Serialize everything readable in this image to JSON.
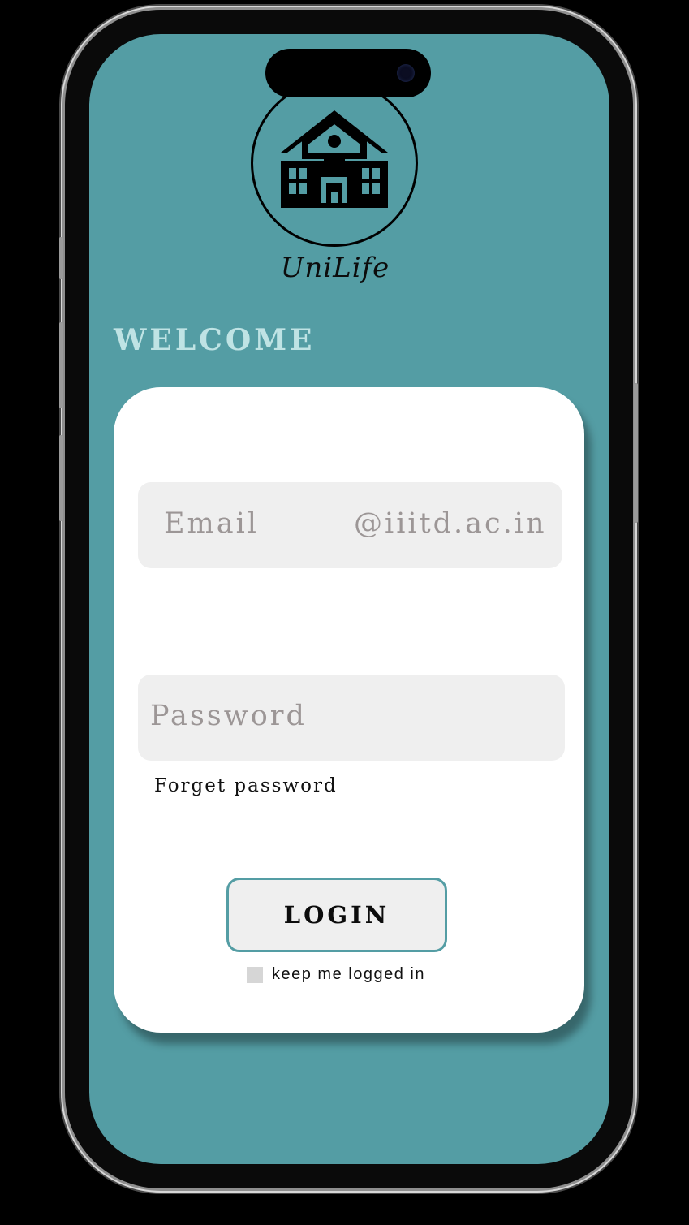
{
  "colors": {
    "screen_bg": "#549da4",
    "welcome_text": "#bfe3e4",
    "card_bg": "#ffffff",
    "field_bg": "#efefef"
  },
  "logo": {
    "icon": "school-building-icon",
    "app_name": "UniLife"
  },
  "welcome": {
    "heading": "WELCOME"
  },
  "login_form": {
    "email_placeholder": "Email",
    "email_domain": "@iiitd.ac.in",
    "password_placeholder": "Password",
    "forgot_password": "Forget password",
    "login_label": "LOGIN",
    "keep_logged_in_label": "keep me logged in",
    "keep_logged_in_checked": false
  }
}
